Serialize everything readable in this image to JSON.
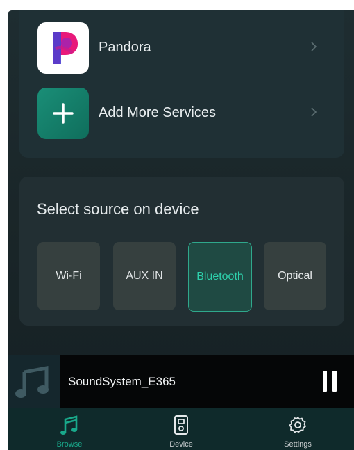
{
  "services": [
    {
      "label": "Pandora",
      "icon": "pandora-logo-icon"
    },
    {
      "label": "Add More Services",
      "icon": "plus-icon"
    }
  ],
  "source": {
    "title": "Select source on device",
    "options": [
      {
        "label": "Wi-Fi",
        "selected": false
      },
      {
        "label": "AUX IN",
        "selected": false
      },
      {
        "label": "Bluetooth",
        "selected": true
      },
      {
        "label": "Optical",
        "selected": false
      }
    ]
  },
  "player": {
    "track": "SoundSystem_E365",
    "state_icon": "pause-icon"
  },
  "tabs": [
    {
      "label": "Browse",
      "icon": "music-note-icon",
      "active": true
    },
    {
      "label": "Device",
      "icon": "speaker-icon",
      "active": false
    },
    {
      "label": "Settings",
      "icon": "gear-icon",
      "active": false
    }
  ],
  "colors": {
    "accent": "#2ed1ac",
    "pandora_blue": "#3551c8",
    "pandora_pink": "#e8197a"
  }
}
